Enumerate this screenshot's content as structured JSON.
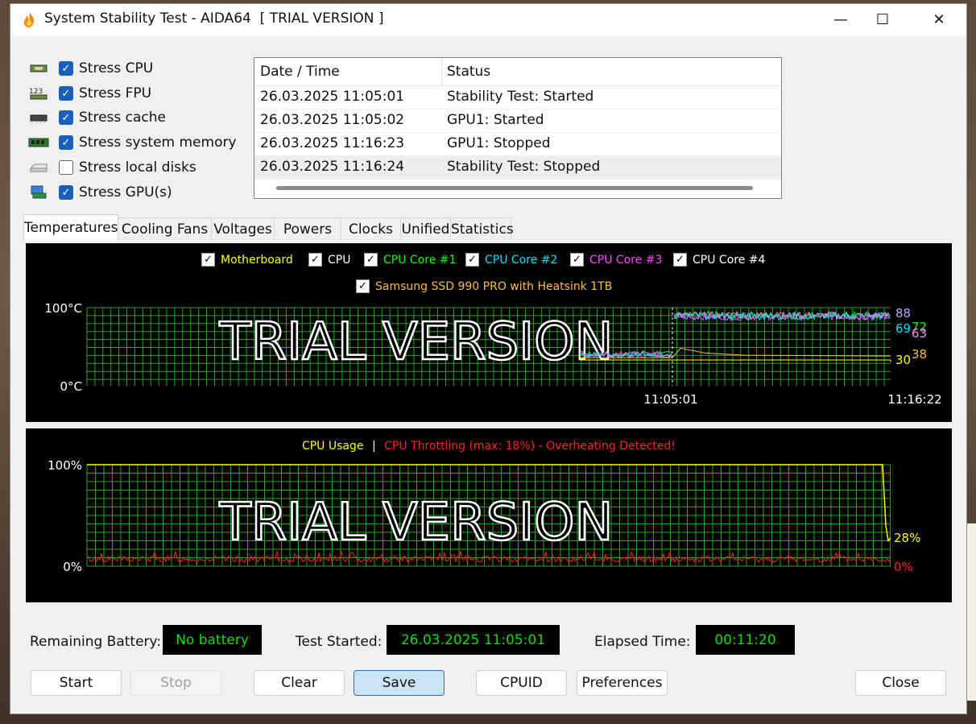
{
  "window": {
    "title": "System Stability Test - AIDA64  [ TRIAL VERSION ]",
    "controls": {
      "minimize": "—",
      "maximize": "☐",
      "close": "✕"
    }
  },
  "stress_options": [
    {
      "label": "Stress CPU",
      "checked": true,
      "icon": "cpu-chip-icon"
    },
    {
      "label": "Stress FPU",
      "checked": true,
      "icon": "fpu-123-icon"
    },
    {
      "label": "Stress cache",
      "checked": true,
      "icon": "cache-chip-icon"
    },
    {
      "label": "Stress system memory",
      "checked": true,
      "icon": "memory-module-icon"
    },
    {
      "label": "Stress local disks",
      "checked": false,
      "icon": "disk-drive-icon"
    },
    {
      "label": "Stress GPU(s)",
      "checked": true,
      "icon": "gpu-card-icon"
    }
  ],
  "log": {
    "headers": [
      "Date / Time",
      "Status"
    ],
    "rows": [
      {
        "datetime": "26.03.2025 11:05:01",
        "status": "Stability Test: Started"
      },
      {
        "datetime": "26.03.2025 11:05:02",
        "status": "GPU1: Started"
      },
      {
        "datetime": "26.03.2025 11:16:23",
        "status": "GPU1: Stopped"
      },
      {
        "datetime": "26.03.2025 11:16:24",
        "status": "Stability Test: Stopped"
      }
    ]
  },
  "tabs": [
    "Temperatures",
    "Cooling Fans",
    "Voltages",
    "Powers",
    "Clocks",
    "Unified",
    "Statistics"
  ],
  "temp_chart": {
    "legend": [
      {
        "label": "Motherboard",
        "color": "#ffff00"
      },
      {
        "label": "CPU",
        "color": "#ffffff"
      },
      {
        "label": "CPU Core #1",
        "color": "#00ff00"
      },
      {
        "label": "CPU Core #2",
        "color": "#00e0ff"
      },
      {
        "label": "CPU Core #3",
        "color": "#ff44ff"
      },
      {
        "label": "CPU Core #4",
        "color": "#ffffff"
      },
      {
        "label": "Samsung SSD 990 PRO with Heatsink 1TB",
        "color": "#ffbb44"
      }
    ],
    "y_top": "100°C",
    "y_bottom": "0°C",
    "x_start": "11:05:01",
    "x_end": "11:16:22",
    "watermark": "TRIAL VERSION",
    "end_values": [
      {
        "text": "88",
        "color": "#aaaaff"
      },
      {
        "text": "69",
        "color": "#00e0ff"
      },
      {
        "text": "72",
        "color": "#00ff00"
      },
      {
        "text": "63",
        "color": "#ff88ff"
      },
      {
        "text": "38",
        "color": "#ffbb44"
      },
      {
        "text": "30",
        "color": "#ffff00"
      }
    ]
  },
  "usage_chart": {
    "title_usage": "CPU Usage",
    "title_sep": "|",
    "title_throttle": "CPU Throttling (max: 18%) - Overheating Detected!",
    "usage_color": "#ffff00",
    "throttle_color": "#ff2020",
    "y_top": "100%",
    "y_bottom": "0%",
    "watermark": "TRIAL VERSION",
    "usage_end": "28%",
    "throttle_end": "0%"
  },
  "chart_data": [
    {
      "type": "line",
      "ylim": [
        0,
        100
      ],
      "x": [
        "11:05:01",
        "11:16:22"
      ],
      "series": [
        {
          "name": "Motherboard",
          "values": [
            34,
            34,
            30
          ]
        },
        {
          "name": "CPU",
          "values": [
            40,
            88,
            88
          ]
        },
        {
          "name": "CPU Core #1",
          "values": [
            40,
            88,
            72
          ]
        },
        {
          "name": "CPU Core #2",
          "values": [
            40,
            88,
            69
          ]
        },
        {
          "name": "CPU Core #3",
          "values": [
            40,
            88,
            63
          ]
        },
        {
          "name": "CPU Core #4",
          "values": [
            40,
            88,
            88
          ]
        },
        {
          "name": "Samsung SSD 990 PRO with Heatsink 1TB",
          "values": [
            36,
            48,
            38
          ]
        }
      ]
    },
    {
      "type": "line",
      "ylim": [
        0,
        100
      ],
      "series": [
        {
          "name": "CPU Usage",
          "values": [
            100,
            100,
            28
          ]
        },
        {
          "name": "CPU Throttling",
          "values": [
            5,
            6,
            0
          ]
        }
      ]
    }
  ],
  "status": {
    "battery_label": "Remaining Battery:",
    "battery_value": "No battery",
    "started_label": "Test Started:",
    "started_value": "26.03.2025 11:05:01",
    "elapsed_label": "Elapsed Time:",
    "elapsed_value": "00:11:20"
  },
  "buttons": {
    "start": "Start",
    "stop": "Stop",
    "clear": "Clear",
    "save": "Save",
    "cpuid": "CPUID",
    "preferences": "Preferences",
    "close": "Close"
  }
}
